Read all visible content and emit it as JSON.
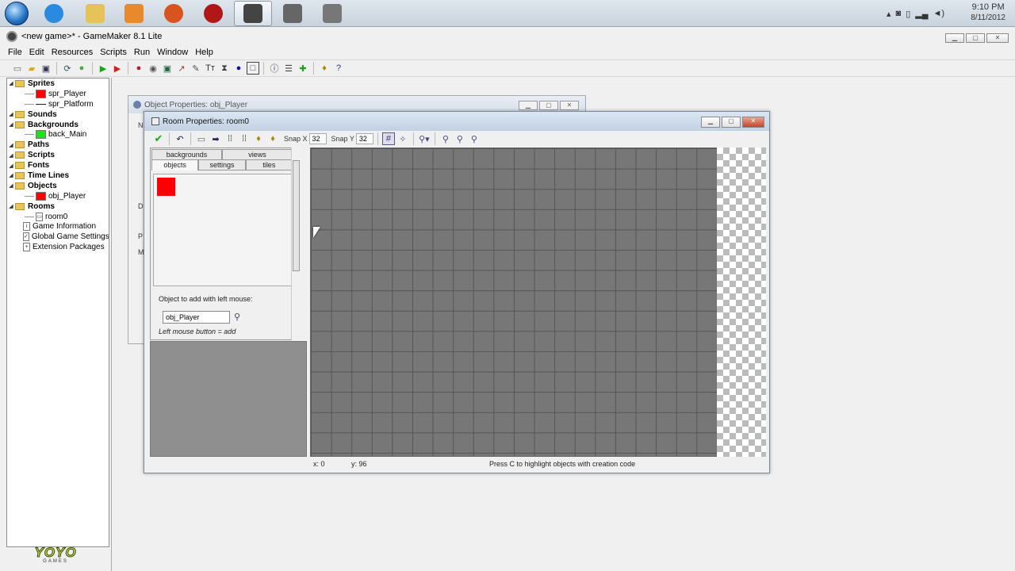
{
  "taskbar": {
    "apps": [
      {
        "name": "internet-explorer-icon",
        "color": "#2a8ae0"
      },
      {
        "name": "folder-icon",
        "color": "#e6c25a"
      },
      {
        "name": "media-player-icon",
        "color": "#e88a2c"
      },
      {
        "name": "firefox-icon",
        "color": "#d8531e"
      },
      {
        "name": "app-target-icon",
        "color": "#b01818"
      },
      {
        "name": "gamemaker-icon",
        "color": "#444444"
      },
      {
        "name": "app-gear-icon",
        "color": "#666666"
      },
      {
        "name": "app-gear2-icon",
        "color": "#777777"
      }
    ],
    "clock": {
      "time": "9:10 PM",
      "date": "8/11/2012"
    }
  },
  "window": {
    "title": "<new game>* - GameMaker 8.1 Lite"
  },
  "menu": [
    "File",
    "Edit",
    "Resources",
    "Scripts",
    "Run",
    "Window",
    "Help"
  ],
  "tree": {
    "items": [
      {
        "label": "Sprites",
        "type": "root"
      },
      {
        "label": "spr_Player",
        "type": "child",
        "swatch": "#ff0000"
      },
      {
        "label": "spr_Platform",
        "type": "child",
        "swatch": "line"
      },
      {
        "label": "Sounds",
        "type": "root"
      },
      {
        "label": "Backgrounds",
        "type": "root"
      },
      {
        "label": "back_Main",
        "type": "child",
        "swatch": "#22dd22"
      },
      {
        "label": "Paths",
        "type": "root"
      },
      {
        "label": "Scripts",
        "type": "root"
      },
      {
        "label": "Fonts",
        "type": "root"
      },
      {
        "label": "Time Lines",
        "type": "root"
      },
      {
        "label": "Objects",
        "type": "root"
      },
      {
        "label": "obj_Player",
        "type": "child",
        "swatch": "#ff0000"
      },
      {
        "label": "Rooms",
        "type": "root"
      },
      {
        "label": "room0",
        "type": "child",
        "swatch": "doc"
      },
      {
        "label": "Game Information",
        "type": "info"
      },
      {
        "label": "Global Game Settings",
        "type": "info"
      },
      {
        "label": "Extension Packages",
        "type": "info"
      }
    ]
  },
  "logo": {
    "text": "YOYO",
    "sub": "GAMES"
  },
  "object_window": {
    "title": "Object Properties: obj_Player",
    "labels": [
      "N",
      "D",
      "P",
      "M"
    ]
  },
  "room_window": {
    "title": "Room Properties: room0",
    "snap_x_label": "Snap X",
    "snap_x": "32",
    "snap_y_label": "Snap Y",
    "snap_y": "32",
    "tabs_top": [
      "backgrounds",
      "views"
    ],
    "tabs_bottom": [
      "objects",
      "settings",
      "tiles"
    ],
    "add_label": "Object to add with left mouse:",
    "add_value": "obj_Player",
    "hint": "Left mouse button = add",
    "status_x": "x: 0",
    "status_y": "y: 96",
    "status_msg": "Press C to highlight objects with creation code"
  }
}
